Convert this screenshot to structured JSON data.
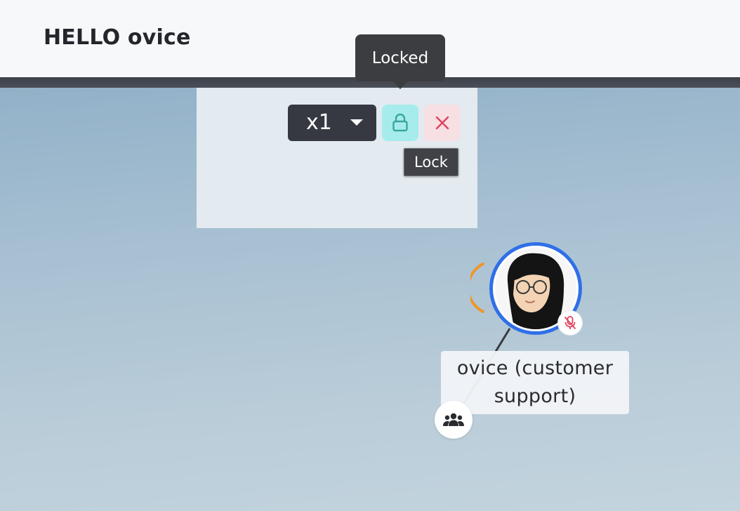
{
  "header": {
    "title": "HELLO ovice"
  },
  "object_controls": {
    "scale_value": "x1",
    "scale_icon": "chevron-down-icon",
    "lock_icon": "lock-icon",
    "close_icon": "close-icon",
    "tooltip_locked": "Locked",
    "tooltip_lock": "Lock"
  },
  "avatar": {
    "name": "ovice (customer support)",
    "ring_color": "#2f6fe8",
    "speaking_color": "#f0952a",
    "mic_status_icon": "mic-muted-icon",
    "group_icon": "group-icon"
  },
  "colors": {
    "lock_button_bg": "#a6ecec",
    "close_button_bg": "#f7e0e3",
    "close_icon_color": "#e0435e",
    "scale_select_bg": "#363942"
  }
}
